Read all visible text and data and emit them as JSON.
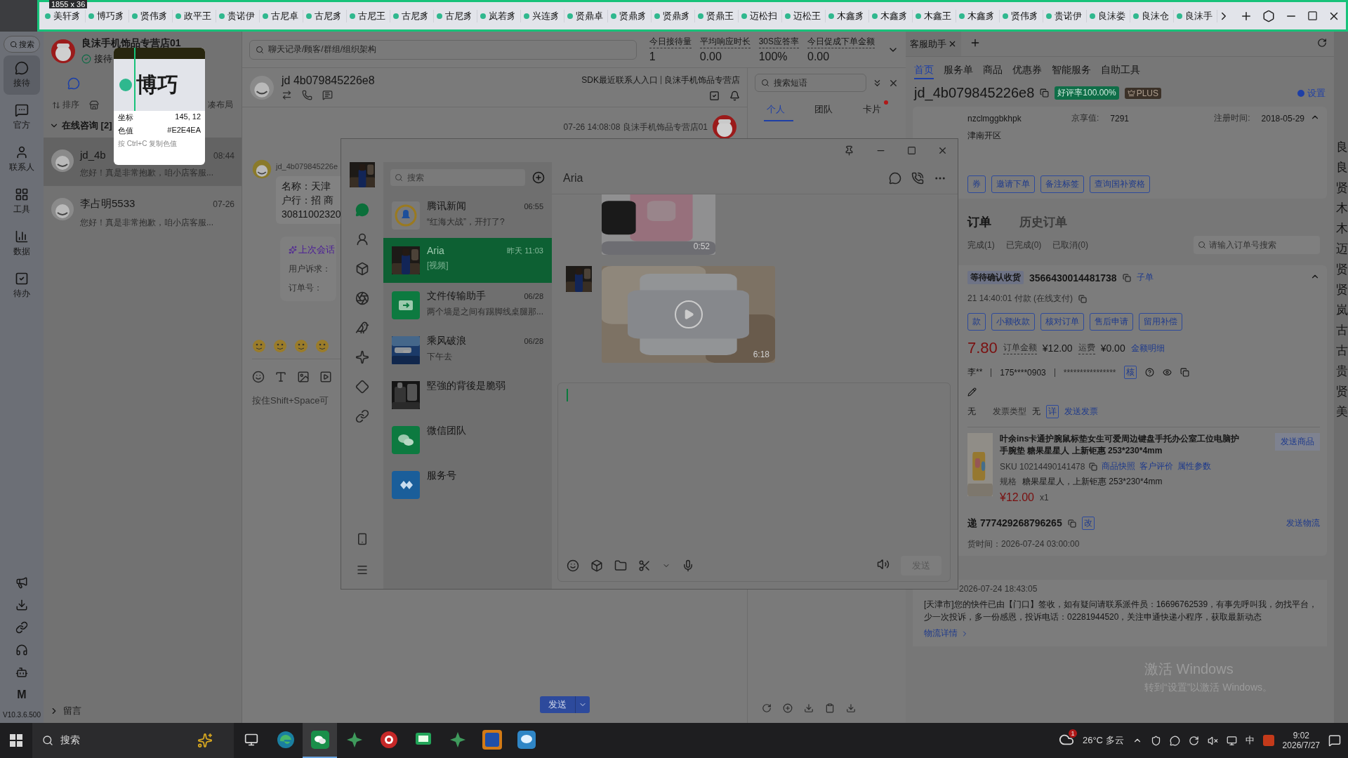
{
  "capture": {
    "size": "1855 x 36"
  },
  "top_tabs": [
    {
      "label": "美轩豸"
    },
    {
      "label": "博巧豸"
    },
    {
      "label": "贤伟豸"
    },
    {
      "label": "政平王"
    },
    {
      "label": "贵诺伊"
    },
    {
      "label": "古尼卓"
    },
    {
      "label": "古尼豸"
    },
    {
      "label": "古尼王"
    },
    {
      "label": "古尼豸"
    },
    {
      "label": "古尼豸"
    },
    {
      "label": "岚若豸"
    },
    {
      "label": "兴连豸"
    },
    {
      "label": "贤鼎卓"
    },
    {
      "label": "贤鼎豸"
    },
    {
      "label": "贤鼎豸"
    },
    {
      "label": "贤鼎王"
    },
    {
      "label": "迈松扫"
    },
    {
      "label": "迈松王"
    },
    {
      "label": "木鑫豸"
    },
    {
      "label": "木鑫豸"
    },
    {
      "label": "木鑫王"
    },
    {
      "label": "木鑫豸"
    },
    {
      "label": "贤伟豸"
    },
    {
      "label": "贵诺伊"
    },
    {
      "label": "良沫娄"
    },
    {
      "label": "良沫仓"
    },
    {
      "label": "良沫手"
    }
  ],
  "magnifier": {
    "zoomed_text": "博巧",
    "rows": [
      {
        "label": "坐标",
        "value": "145, 12"
      },
      {
        "label": "色值",
        "value": "#E2E4EA"
      }
    ],
    "hint": "按 Ctrl+C 复制色值"
  },
  "left_rail": {
    "search": "搜索",
    "items": [
      {
        "label": "接待",
        "selected": true
      },
      {
        "label": "官方",
        "selected": false
      },
      {
        "label": "联系人",
        "selected": false
      },
      {
        "label": "工具",
        "selected": false
      },
      {
        "label": "数据",
        "selected": false
      },
      {
        "label": "待办",
        "selected": false
      }
    ],
    "brand_letter": "M",
    "version": "V10.3.6.500"
  },
  "chat_list": {
    "shop_name": "良沫手机饰品专营店01",
    "status": "接待",
    "sort": "排序",
    "layout": "凑布局",
    "group": {
      "title": "在线咨询 [2]",
      "expanded": true
    },
    "items": [
      {
        "name": "jd_4b",
        "time": "08:44",
        "preview": "您好！真是非常抱歉，咱小店客服...",
        "selected": true
      },
      {
        "name": "李占明5533",
        "time": "07-26",
        "preview": "您好！真是非常抱歉，咱小店客服...",
        "selected": false
      }
    ],
    "footer": "留言"
  },
  "chat": {
    "search_placeholder": "聊天记录/顾客/群组/组织架构",
    "stats": [
      {
        "label": "今日接待量",
        "value": "1"
      },
      {
        "label": "平均响应时长",
        "value": "0.00"
      },
      {
        "label": "30S应答率",
        "value": "100%"
      },
      {
        "label": "今日促成下单金额",
        "value": "0.00"
      }
    ],
    "customer": "jd 4b079845226e8",
    "source": "SDK最近联系人入口",
    "shop": "良沫手机饰品专营店",
    "meta": "07-26 14:08:08 良沫手机饰品专营店01",
    "sender": "jd_4b079845226e",
    "bubble_lines": [
      "名称：天津",
      "户行：招 商",
      "30811002320"
    ],
    "summary": {
      "title": "上次会话",
      "rows": [
        "用户诉求：",
        "订单号："
      ]
    },
    "input_placeholder": "按住Shift+Space可",
    "send": "发送"
  },
  "quick_phrases": {
    "placeholder": "搜索短语",
    "tabs": [
      {
        "label": "个人",
        "selected": true,
        "dot": false
      },
      {
        "label": "团队",
        "selected": false,
        "dot": false
      },
      {
        "label": "卡片",
        "selected": false,
        "dot": true
      }
    ]
  },
  "assistant": {
    "tab": "客服助手",
    "nav": [
      {
        "label": "首页",
        "selected": true
      },
      {
        "label": "服务单",
        "selected": false
      },
      {
        "label": "商品",
        "selected": false
      },
      {
        "label": "优惠券",
        "selected": false
      },
      {
        "label": "智能服务",
        "selected": false
      },
      {
        "label": "自助工具",
        "selected": false
      }
    ],
    "customer_id": "jd_4b079845226e8",
    "rating": "好评率100.00%",
    "plus": "PLUS",
    "settings": {
      "label": "设置",
      "checked": true
    },
    "info": {
      "account": "nzclmggbkhpk",
      "score_label": "京享值:",
      "score": "7291",
      "reg_label": "注册时间:",
      "reg": "2018-05-29",
      "address": "津南开区"
    },
    "actions": [
      "券",
      "邀请下单",
      "备注标签",
      "查询国补资格"
    ],
    "order_tabs": [
      {
        "label": "订单",
        "selected": true
      },
      {
        "label": "历史订单",
        "selected": false
      }
    ],
    "filters": [
      "完成(1)",
      "已完成(0)",
      "已取消(0)"
    ],
    "order_search": "请输入订单号搜索",
    "order": {
      "status": "等待确认收货",
      "number": "3566430014481738",
      "sub": "子单",
      "paid": "21 14:40:01 付款 (在线支付)",
      "buttons": [
        "款",
        "小额收款",
        "核对订单",
        "售后申请",
        "留用补偿"
      ],
      "price": "7.80",
      "amount_label": "订单金额",
      "amount": "¥12.00",
      "freight_label": "运费",
      "freight": "¥0.00",
      "detail_link": "金额明细",
      "buyer": "李**",
      "phone": "175****0903",
      "masked": "****************",
      "verify": "核",
      "invoice": {
        "value": "无",
        "type_label": "发票类型",
        "type": "无",
        "detail": "详",
        "send": "发送发票"
      },
      "product": {
        "title": "叶余ins卡通护腕鼠标垫女生可爱周边键盘手托办公室工位电脑护手腕垫 糖果星星人 上新钜惠 253*230*4mm",
        "send": "发送商品",
        "sku": "SKU 10214490141478",
        "links": [
          "商品快照",
          "客户评价",
          "属性参数"
        ],
        "spec_label": "规格",
        "spec": "糖果星星人，上新钜惠 253*230*4mm",
        "price": "¥12.00",
        "qty": "x1"
      }
    },
    "logistics": {
      "number": "递 777429268796265",
      "edit": "改",
      "send": "发送物流",
      "ship_time": "货时间：2026-07-24 03:00:00",
      "track_time": "2026-07-24 18:43:05",
      "track_text": "[天津市]您的快件已由【门口】签收，如有疑问请联系派件员：16696762539，有事先呼叫我，勿找平台，少一次投诉，多一份感恩，投诉电话：02281944520，关注申通快递小程序，获取最新动态",
      "detail": "物流详情"
    }
  },
  "edge_list": [
    "良",
    "良",
    "贤",
    "木",
    "木",
    "迈",
    "贤",
    "贤",
    "岚",
    "古",
    "古",
    "贵",
    "贤",
    "美"
  ],
  "activation": {
    "title": "激活 Windows",
    "subtitle": "转到“设置”以激活 Windows。"
  },
  "wechat": {
    "rail": [
      {
        "selected": true
      },
      {
        "selected": false
      },
      {
        "selected": false
      },
      {
        "selected": false
      },
      {
        "selected": false
      },
      {
        "selected": false
      },
      {
        "selected": false
      },
      {
        "selected": false
      }
    ],
    "list_search": "搜索",
    "conversations": [
      {
        "name": "腾讯新闻",
        "time": "06:55",
        "preview": "“红海大战”，开打了?",
        "kind": "news",
        "selected": false
      },
      {
        "name": "Aria",
        "time": "昨天 11:03",
        "preview": "[视频]",
        "selected": true
      },
      {
        "name": "文件传输助手",
        "time": "06/28",
        "preview": "两个墙是之间有踢脚线桌腿那...",
        "kind": "file",
        "selected": false
      },
      {
        "name": "乘风破浪",
        "time": "06/28",
        "preview": "下午去",
        "selected": false
      },
      {
        "name": "堅強的背後是脆弱",
        "selected": false
      },
      {
        "name": "微信团队",
        "kind": "wechat",
        "selected": false
      },
      {
        "name": "服务号",
        "kind": "service",
        "selected": false
      }
    ],
    "chat_title": "Aria",
    "videos": [
      {
        "duration": "0:52"
      },
      {
        "duration": "6:18"
      }
    ],
    "send": {
      "label": "发送",
      "disabled": true
    }
  },
  "taskbar": {
    "search": "搜索",
    "apps": [
      {
        "kind": "taskview",
        "active": false
      },
      {
        "kind": "edge",
        "active": false
      },
      {
        "kind": "wechat",
        "active": true
      },
      {
        "kind": "star",
        "active": false
      },
      {
        "kind": "record",
        "active": false
      },
      {
        "kind": "chat",
        "active": false
      },
      {
        "kind": "star",
        "active": false
      },
      {
        "kind": "m",
        "active": false
      },
      {
        "kind": "bubble",
        "active": false
      }
    ],
    "weather": "26°C 多云",
    "weather_badge": "1",
    "ime": "中",
    "time": "9:02",
    "date": "2026/7/27"
  }
}
